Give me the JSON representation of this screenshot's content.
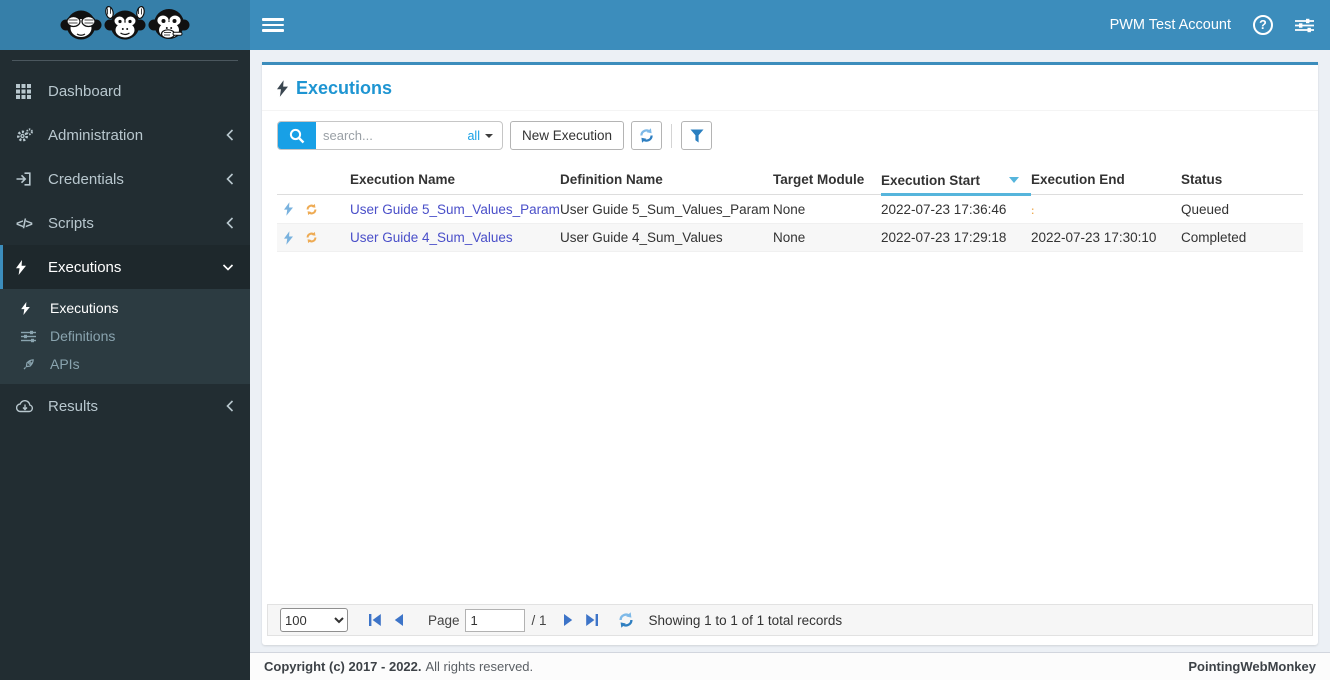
{
  "colors": {
    "navbar": "#3c8dbc",
    "logo_area": "#367fa9",
    "sidebar_bg": "#222d32",
    "submenu_bg": "#2c3b41",
    "active_item_bg": "#1e282c",
    "accent_blue": "#3c8dbc",
    "title_blue": "#1e95d2",
    "search_blue": "#18a0e6",
    "link_color": "#4a4fc9",
    "sort_accent": "#56b5dc",
    "content_bg": "#ecf0f5",
    "row_bolt_blue": "#79b2de",
    "row_refresh_orange": "#eeab54"
  },
  "topbar": {
    "account": "PWM Test Account"
  },
  "icons": {
    "help_glyph": "?",
    "scripts_glyph": "</>"
  },
  "sidebar": {
    "items": [
      {
        "label": "Dashboard"
      },
      {
        "label": "Administration"
      },
      {
        "label": "Credentials"
      },
      {
        "label": "Scripts"
      },
      {
        "label": "Executions"
      },
      {
        "label": "Results"
      }
    ],
    "executions_submenu": [
      {
        "label": "Executions"
      },
      {
        "label": "Definitions"
      },
      {
        "label": "APIs"
      }
    ]
  },
  "main": {
    "title": "Executions",
    "toolbar": {
      "search_placeholder": "search...",
      "search_scope": "all",
      "new_execution": "New Execution"
    },
    "table": {
      "columns": [
        "Execution Name",
        "Definition Name",
        "Target Module",
        "Execution Start",
        "Execution End",
        "Status"
      ],
      "sorted_column": "Execution Start",
      "sort_direction": "desc",
      "rows": [
        {
          "execution_name": "User Guide 5_Sum_Values_Param",
          "definition_name": "User Guide 5_Sum_Values_Param",
          "target_module": "None",
          "execution_start": "2022-07-23 17:36:46",
          "execution_end": "",
          "status": "Queued"
        },
        {
          "execution_name": "User Guide 4_Sum_Values",
          "definition_name": "User Guide 4_Sum_Values",
          "target_module": "None",
          "execution_start": "2022-07-23 17:29:18",
          "execution_end": "2022-07-23 17:30:10",
          "status": "Completed"
        }
      ]
    },
    "pagination": {
      "page_size": "100",
      "page_label": "Page",
      "current_page": "1",
      "total_pages": "/ 1",
      "summary": "Showing 1 to 1 of 1 total records"
    }
  },
  "footer": {
    "copyright_bold": "Copyright (c) 2017 - 2022.",
    "copyright_rest": "All rights reserved.",
    "brand": "PointingWebMonkey"
  }
}
